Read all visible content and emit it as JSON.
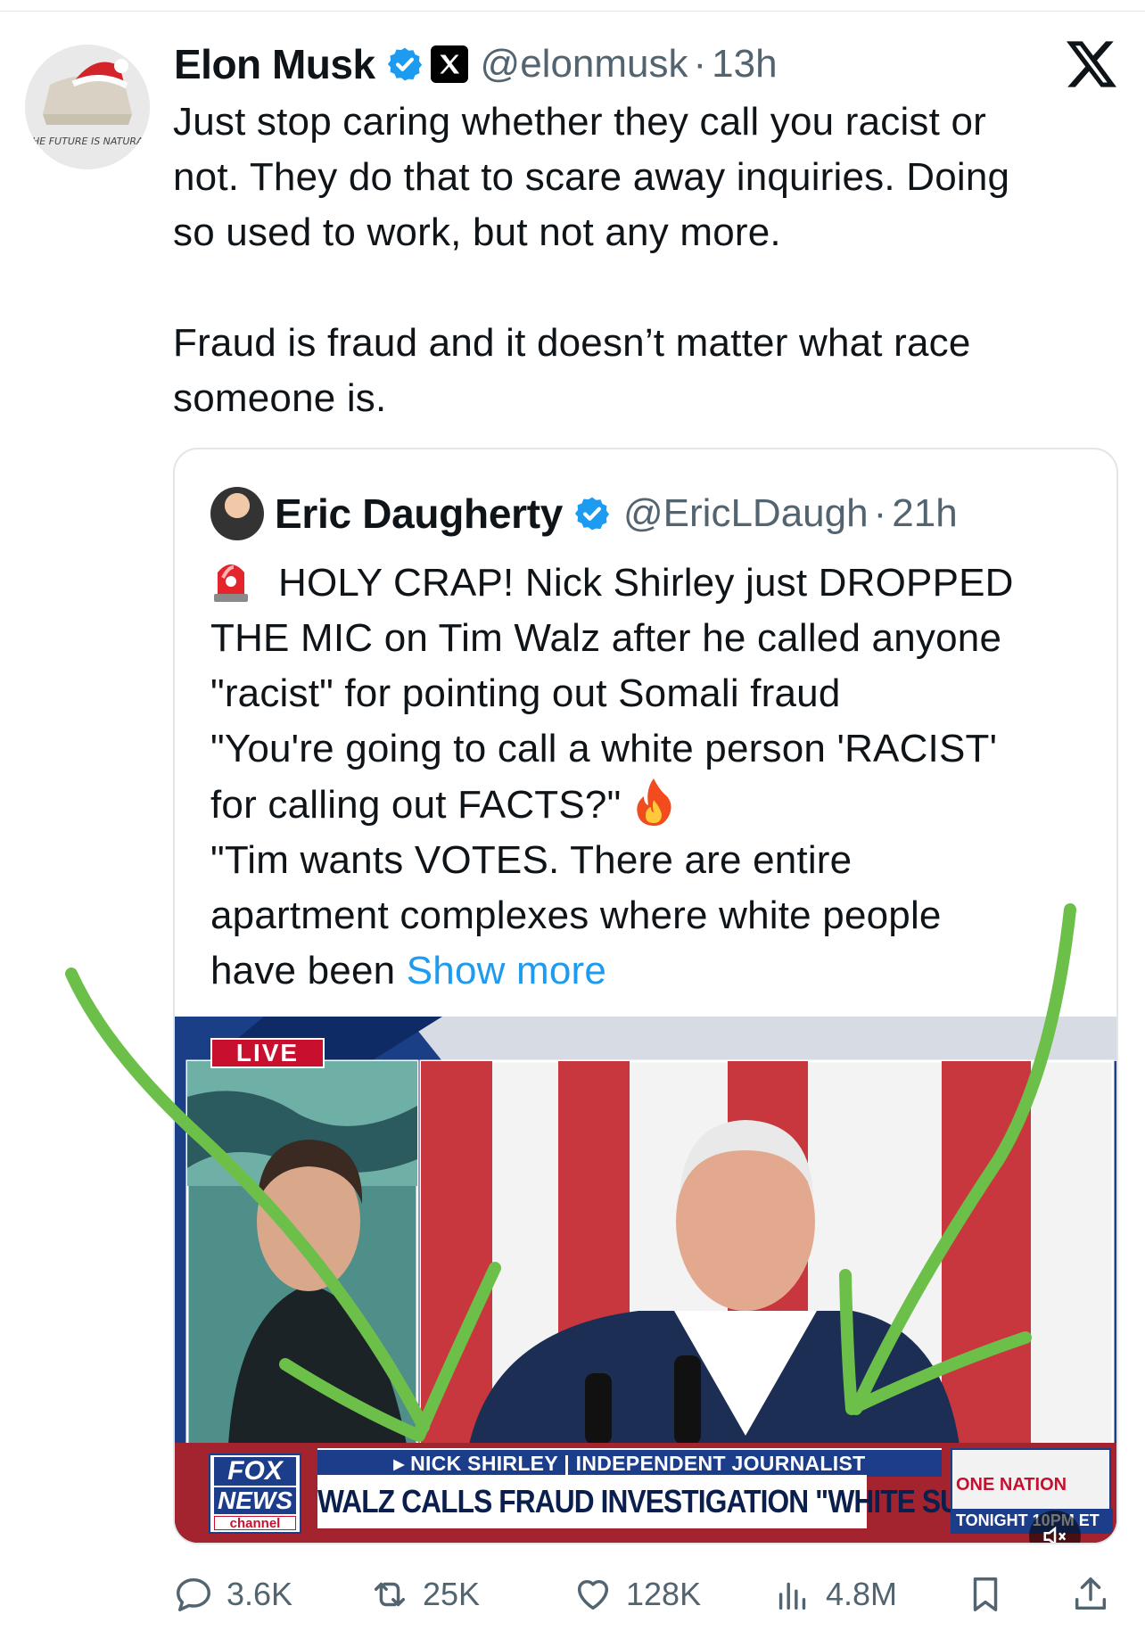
{
  "tweet": {
    "author_name": "Elon Musk",
    "handle": "@elonmusk",
    "separator": "·",
    "time": "13h",
    "text": "Just stop caring whether they call you racist or\nnot. They do that to scare away inquiries. Doing\nso used to work, but not any more.\n\nFraud is fraud and it doesn’t matter what race\nsomeone is.",
    "avatar_caption": "THE FUTURE IS NATURAL"
  },
  "quote": {
    "author_name": "Eric Daugherty",
    "handle": "@EricLDaugh",
    "separator": "·",
    "time": "21h",
    "lines": [
      "HOLY CRAP! Nick Shirley just DROPPED",
      "THE MIC on Tim Walz after he called anyone",
      "\"racist\" for pointing out Somali fraud",
      "\"You're going to call a white person 'RACIST'",
      "for calling out FACTS?\"",
      "\"Tim wants VOTES. There are entire",
      "apartment complexes where white people",
      "have been "
    ],
    "show_more": "Show more"
  },
  "video": {
    "live_label": "LIVE",
    "lower_third_name": "▸ NICK SHIRLEY | INDEPENDENT JOURNALIST",
    "headline": "WALZ CALLS FRAUD INVESTIGATION \"WHITE SUPREMACY\"",
    "logo_line1": "FOX",
    "logo_line2": "NEWS",
    "logo_line3": "channel",
    "promo_title": "ONE NATION",
    "promo_time": "TONIGHT 10PM ET"
  },
  "actions": {
    "replies": "3.6K",
    "reposts": "25K",
    "likes": "128K",
    "views": "4.8M"
  },
  "colors": {
    "verified": "#1d9bf0",
    "link": "#1d9bf0",
    "muted_text": "#536471",
    "annotation_arrow": "#6cc04a",
    "fox_blue": "#1c3d8a"
  }
}
